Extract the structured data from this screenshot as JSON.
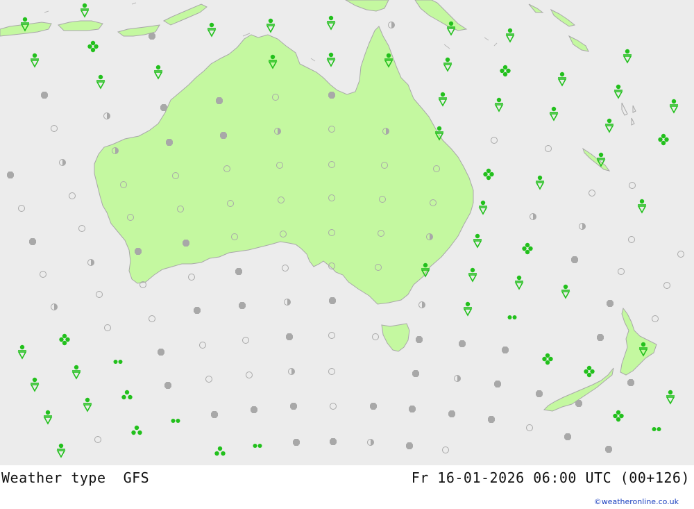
{
  "footer": {
    "title": "Weather type",
    "model": "GFS",
    "datetime": "Fr 16-01-2026 06:00 UTC (00+126)",
    "credit": "©weatheronline.co.uk"
  },
  "colors": {
    "ocean": "#ececec",
    "land": "#c4f8a0",
    "coast": "#a8a8a8",
    "symbol_green": "#22c01c",
    "symbol_grey": "#a8a8a8"
  },
  "legend_symbols": {
    "cloudy": "filled grey dot",
    "clear": "open grey circle",
    "partly_cloudy": "half-filled grey circle",
    "rain_shower": "green drop over triangle",
    "rain": "green two/three dots"
  }
}
